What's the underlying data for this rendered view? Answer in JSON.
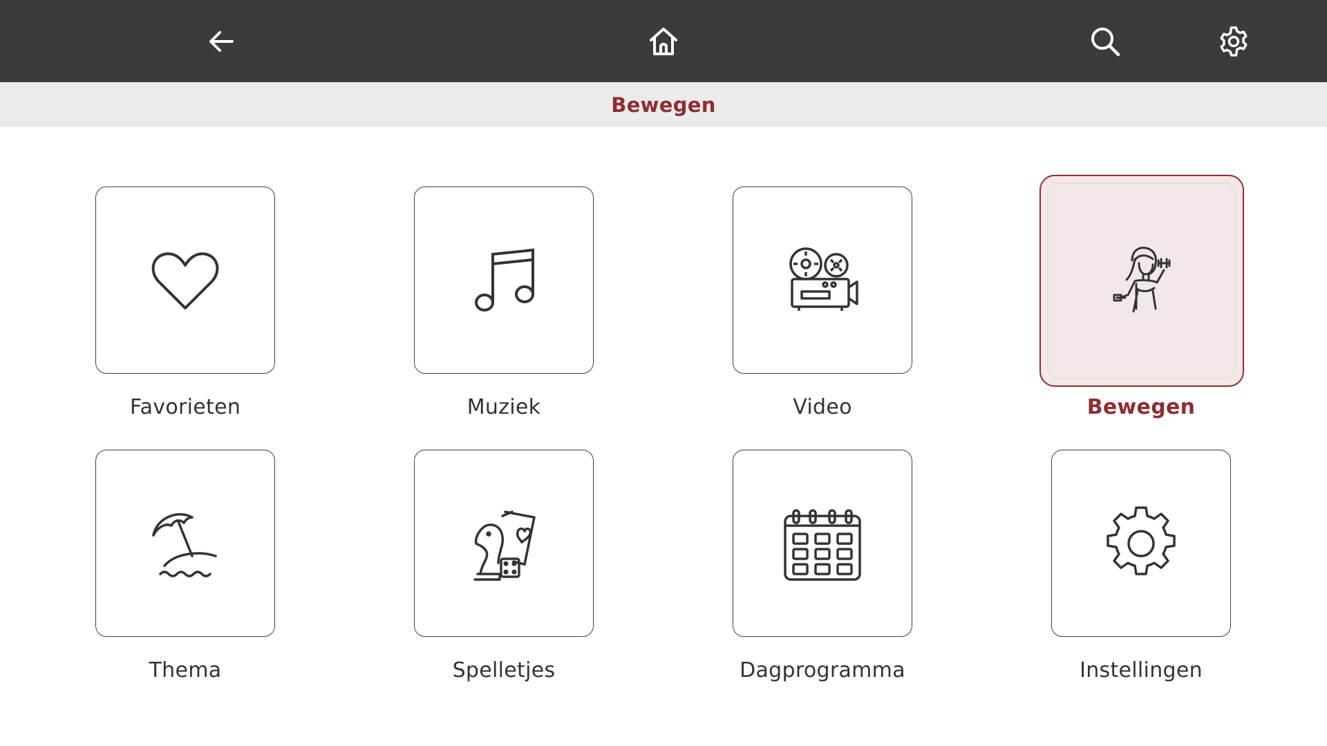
{
  "header": {
    "back_icon": "arrow-left-icon",
    "home_icon": "home-icon",
    "search_icon": "search-icon",
    "settings_icon": "gear-icon",
    "background": "#3b3b3b"
  },
  "breadcrumb": {
    "title": "Bewegen",
    "color": "#8e2d33"
  },
  "tiles": [
    {
      "label": "Favorieten",
      "icon": "heart-icon",
      "active": false
    },
    {
      "label": "Muziek",
      "icon": "music-note-icon",
      "active": false
    },
    {
      "label": "Video",
      "icon": "film-projector-icon",
      "active": false
    },
    {
      "label": "Bewegen",
      "icon": "fitness-woman-icon",
      "active": true
    },
    {
      "label": "Thema",
      "icon": "beach-umbrella-icon",
      "active": false
    },
    {
      "label": "Spelletjes",
      "icon": "games-icon",
      "active": false
    },
    {
      "label": "Dagprogramma",
      "icon": "calendar-icon",
      "active": false
    },
    {
      "label": "Instellingen",
      "icon": "settings-gear-icon",
      "active": false
    }
  ],
  "colors": {
    "accent": "#8e2d33",
    "active_tile_bg": "#f4e8e8"
  }
}
